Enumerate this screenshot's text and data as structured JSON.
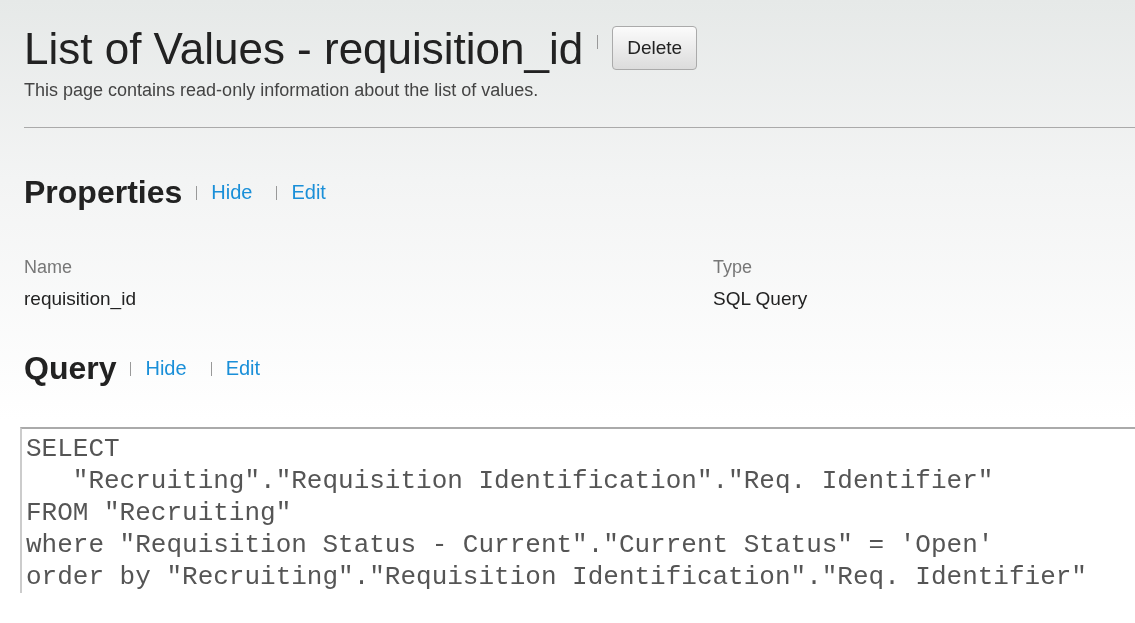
{
  "header": {
    "title": "List of Values - requisition_id",
    "delete_button": "Delete",
    "description": "This page contains read-only information about the list of values."
  },
  "properties": {
    "heading": "Properties",
    "links": [
      "Hide",
      "Edit"
    ],
    "fields": [
      {
        "label": "Name",
        "value": "requisition_id"
      },
      {
        "label": "Type",
        "value": "SQL Query"
      }
    ]
  },
  "query": {
    "heading": "Query",
    "links": [
      "Hide",
      "Edit"
    ],
    "lines": [
      "SELECT",
      "   \"Recruiting\".\"Requisition Identification\".\"Req. Identifier\"",
      "FROM \"Recruiting\"",
      "where \"Requisition Status - Current\".\"Current Status\" = 'Open'",
      "order by \"Recruiting\".\"Requisition Identification\".\"Req. Identifier\""
    ]
  }
}
